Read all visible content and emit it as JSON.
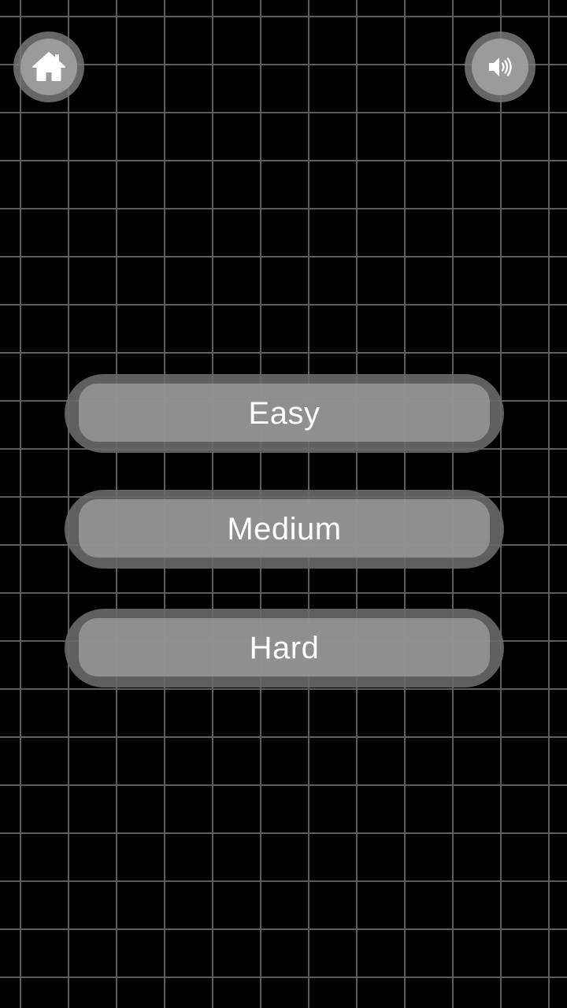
{
  "header": {
    "home_icon": "home-icon",
    "sound_icon": "speaker-on-icon"
  },
  "difficulty_menu": {
    "options": [
      {
        "label": "Easy"
      },
      {
        "label": "Medium"
      },
      {
        "label": "Hard"
      }
    ]
  },
  "colors": {
    "background": "#000000",
    "grid_line": "#5e5e5e",
    "button_outer": "#696969",
    "button_face": "#969696",
    "text": "#ffffff"
  }
}
